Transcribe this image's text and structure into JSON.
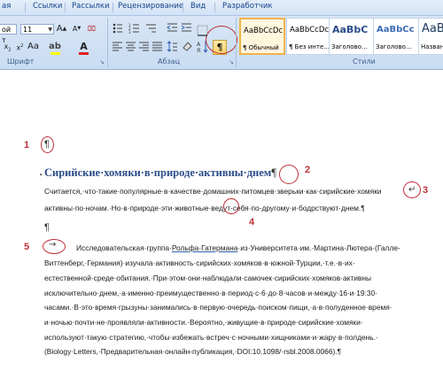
{
  "ribbon": {
    "tabs": [
      "ая",
      "Ссылки",
      "Рассылки",
      "Рецензирование",
      "Вид",
      "Разработчик"
    ],
    "font_name": "ой т",
    "font_size": "11",
    "font_group_label": "Шрифт",
    "paragraph_group_label": "Абзац",
    "styles_group_label": "Стили",
    "pilcrow_button": "¶",
    "styles": [
      {
        "sample": "AaBbCcDc",
        "name": "¶ Обычный"
      },
      {
        "sample": "AaBbCcDc",
        "name": "¶ Без инте..."
      },
      {
        "sample": "AaBbC",
        "name": "Заголово..."
      },
      {
        "sample": "AaBbCc",
        "name": "Заголово..."
      },
      {
        "sample": "AaB",
        "name": "Назван"
      }
    ]
  },
  "annotations": [
    "1",
    "2",
    "3",
    "4",
    "5"
  ],
  "document": {
    "pilcrow": "¶",
    "title": "Сирийские·хомяки·в·природе·активны·днем",
    "para1": [
      "Считается,·что·такие·популярные·в·качестве·домашних·питомцев·зверьки·как·сирийские·хомяки",
      "активны·по·ночам.·Но·в·природе·эти·животные·ведут·себя·по-другому·и·бодрствуют·днем.¶"
    ],
    "para2_first_word": "Исследовательская·группа·",
    "para2_first_link": "Рольфа·Гатермана",
    "para2_first_rest": "·из·Университета·им.·Мартина·Лютера·(Галле-",
    "para2": [
      "Виттенберг,·Германия)·изучала·активность·сирийских·хомяков·в·южной·Турции,·т.е.·в·их·",
      "естественной·среде·обитания.·При·этом·они·наблюдали·самочек·сирийских·хомяков·активны",
      "исключительно·днем,·а·именно·преимущественно·в·период·с·6·до·8·часов·и·между·16·и·19:30·",
      "часами.·В·это·время·грызуны·занимались·в·первую·очередь·поиском·пищи,·а·в·полуденное·время·",
      "и·ночью·почти·не·проявляли·активности.·Вероятно,·живущие·в·природе·сирийские·хомяки·",
      "используют·такую·стратегию,·чтобы·избежать·встреч·с·ночными·хищниками·и·жару·в·полдень.·",
      "(Biology·Letters,·Предварительная·онлайн-публикация,·DOI:10.1098/·rsbl.2008.0066).¶"
    ],
    "tab_arrow": "→",
    "line_break": "↵"
  }
}
